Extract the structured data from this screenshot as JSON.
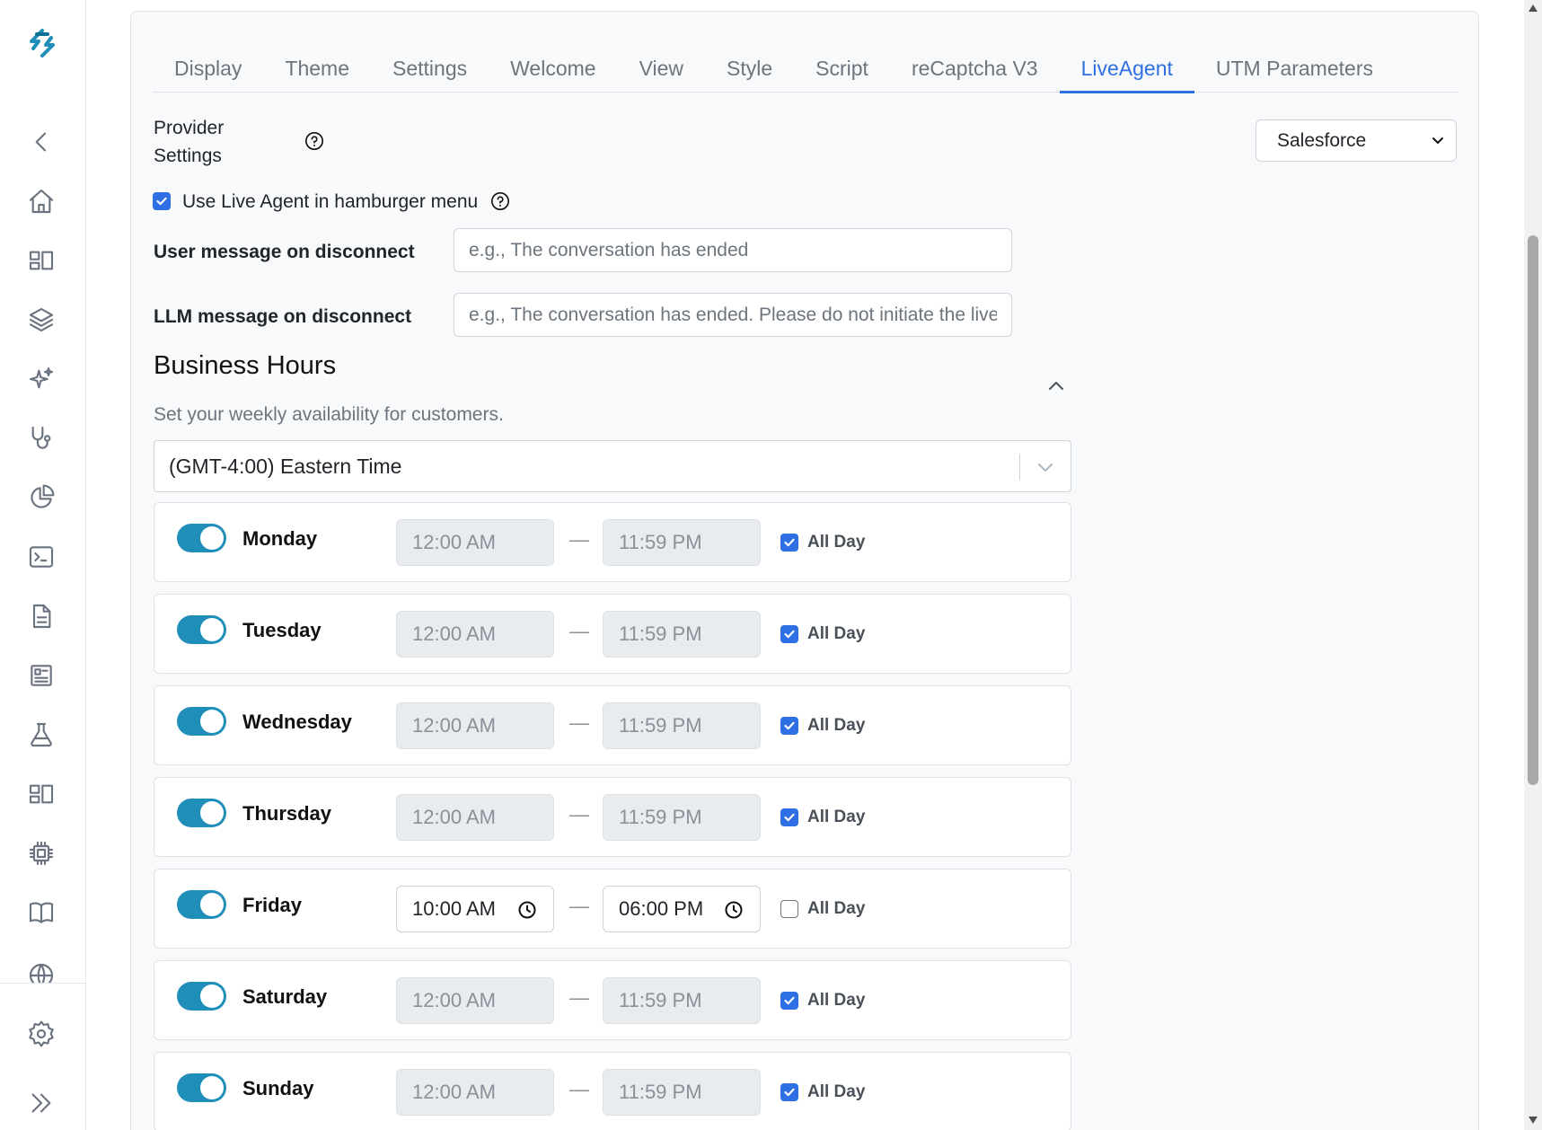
{
  "brand_color": "#1f8eb8",
  "accent_color": "#2f6fe4",
  "sidebar": {
    "logo": "logo-icon",
    "items": [
      {
        "icon": "chevron-left-icon"
      },
      {
        "icon": "home-icon"
      },
      {
        "icon": "dashboard-icon"
      },
      {
        "icon": "layers-icon"
      },
      {
        "icon": "sparkles-icon"
      },
      {
        "icon": "stethoscope-icon"
      },
      {
        "icon": "pie-chart-icon"
      },
      {
        "icon": "terminal-icon"
      },
      {
        "icon": "document-icon"
      },
      {
        "icon": "newspaper-icon"
      },
      {
        "icon": "flask-icon"
      },
      {
        "icon": "dashboard-icon"
      },
      {
        "icon": "chip-icon"
      },
      {
        "icon": "book-icon"
      },
      {
        "icon": "globe-icon"
      }
    ],
    "bottom": [
      {
        "icon": "gear-icon"
      },
      {
        "icon": "double-chevron-right-icon"
      }
    ]
  },
  "tabs": [
    {
      "label": "Display",
      "active": false
    },
    {
      "label": "Theme",
      "active": false
    },
    {
      "label": "Settings",
      "active": false
    },
    {
      "label": "Welcome",
      "active": false
    },
    {
      "label": "View",
      "active": false
    },
    {
      "label": "Style",
      "active": false
    },
    {
      "label": "Script",
      "active": false
    },
    {
      "label": "reCaptcha V3",
      "active": false
    },
    {
      "label": "LiveAgent",
      "active": true
    },
    {
      "label": "UTM Parameters",
      "active": false
    }
  ],
  "provider": {
    "label_line1": "Provider",
    "label_line2": "Settings",
    "selected": "Salesforce"
  },
  "live_agent": {
    "checked": true,
    "label": "Use Live Agent in hamburger menu"
  },
  "fields": {
    "user_disconnect": {
      "label": "User message on disconnect",
      "value": "",
      "placeholder": "e.g., The conversation has ended"
    },
    "llm_disconnect": {
      "label": "LLM message on disconnect",
      "value": "",
      "placeholder": "e.g., The conversation has ended. Please do not initiate the live agent"
    }
  },
  "business_hours": {
    "title": "Business Hours",
    "subtitle": "Set your weekly availability for customers.",
    "timezone": "(GMT-4:00) Eastern Time",
    "dash": "—",
    "all_day_label": "All Day",
    "days": [
      {
        "name": "Monday",
        "enabled": true,
        "start": "12:00 AM",
        "end": "11:59 PM",
        "all_day": true
      },
      {
        "name": "Tuesday",
        "enabled": true,
        "start": "12:00 AM",
        "end": "11:59 PM",
        "all_day": true
      },
      {
        "name": "Wednesday",
        "enabled": true,
        "start": "12:00 AM",
        "end": "11:59 PM",
        "all_day": true
      },
      {
        "name": "Thursday",
        "enabled": true,
        "start": "12:00 AM",
        "end": "11:59 PM",
        "all_day": true
      },
      {
        "name": "Friday",
        "enabled": true,
        "start": "10:00 AM",
        "end": "06:00 PM",
        "all_day": false
      },
      {
        "name": "Saturday",
        "enabled": true,
        "start": "12:00 AM",
        "end": "11:59 PM",
        "all_day": true
      },
      {
        "name": "Sunday",
        "enabled": true,
        "start": "12:00 AM",
        "end": "11:59 PM",
        "all_day": true
      }
    ]
  }
}
